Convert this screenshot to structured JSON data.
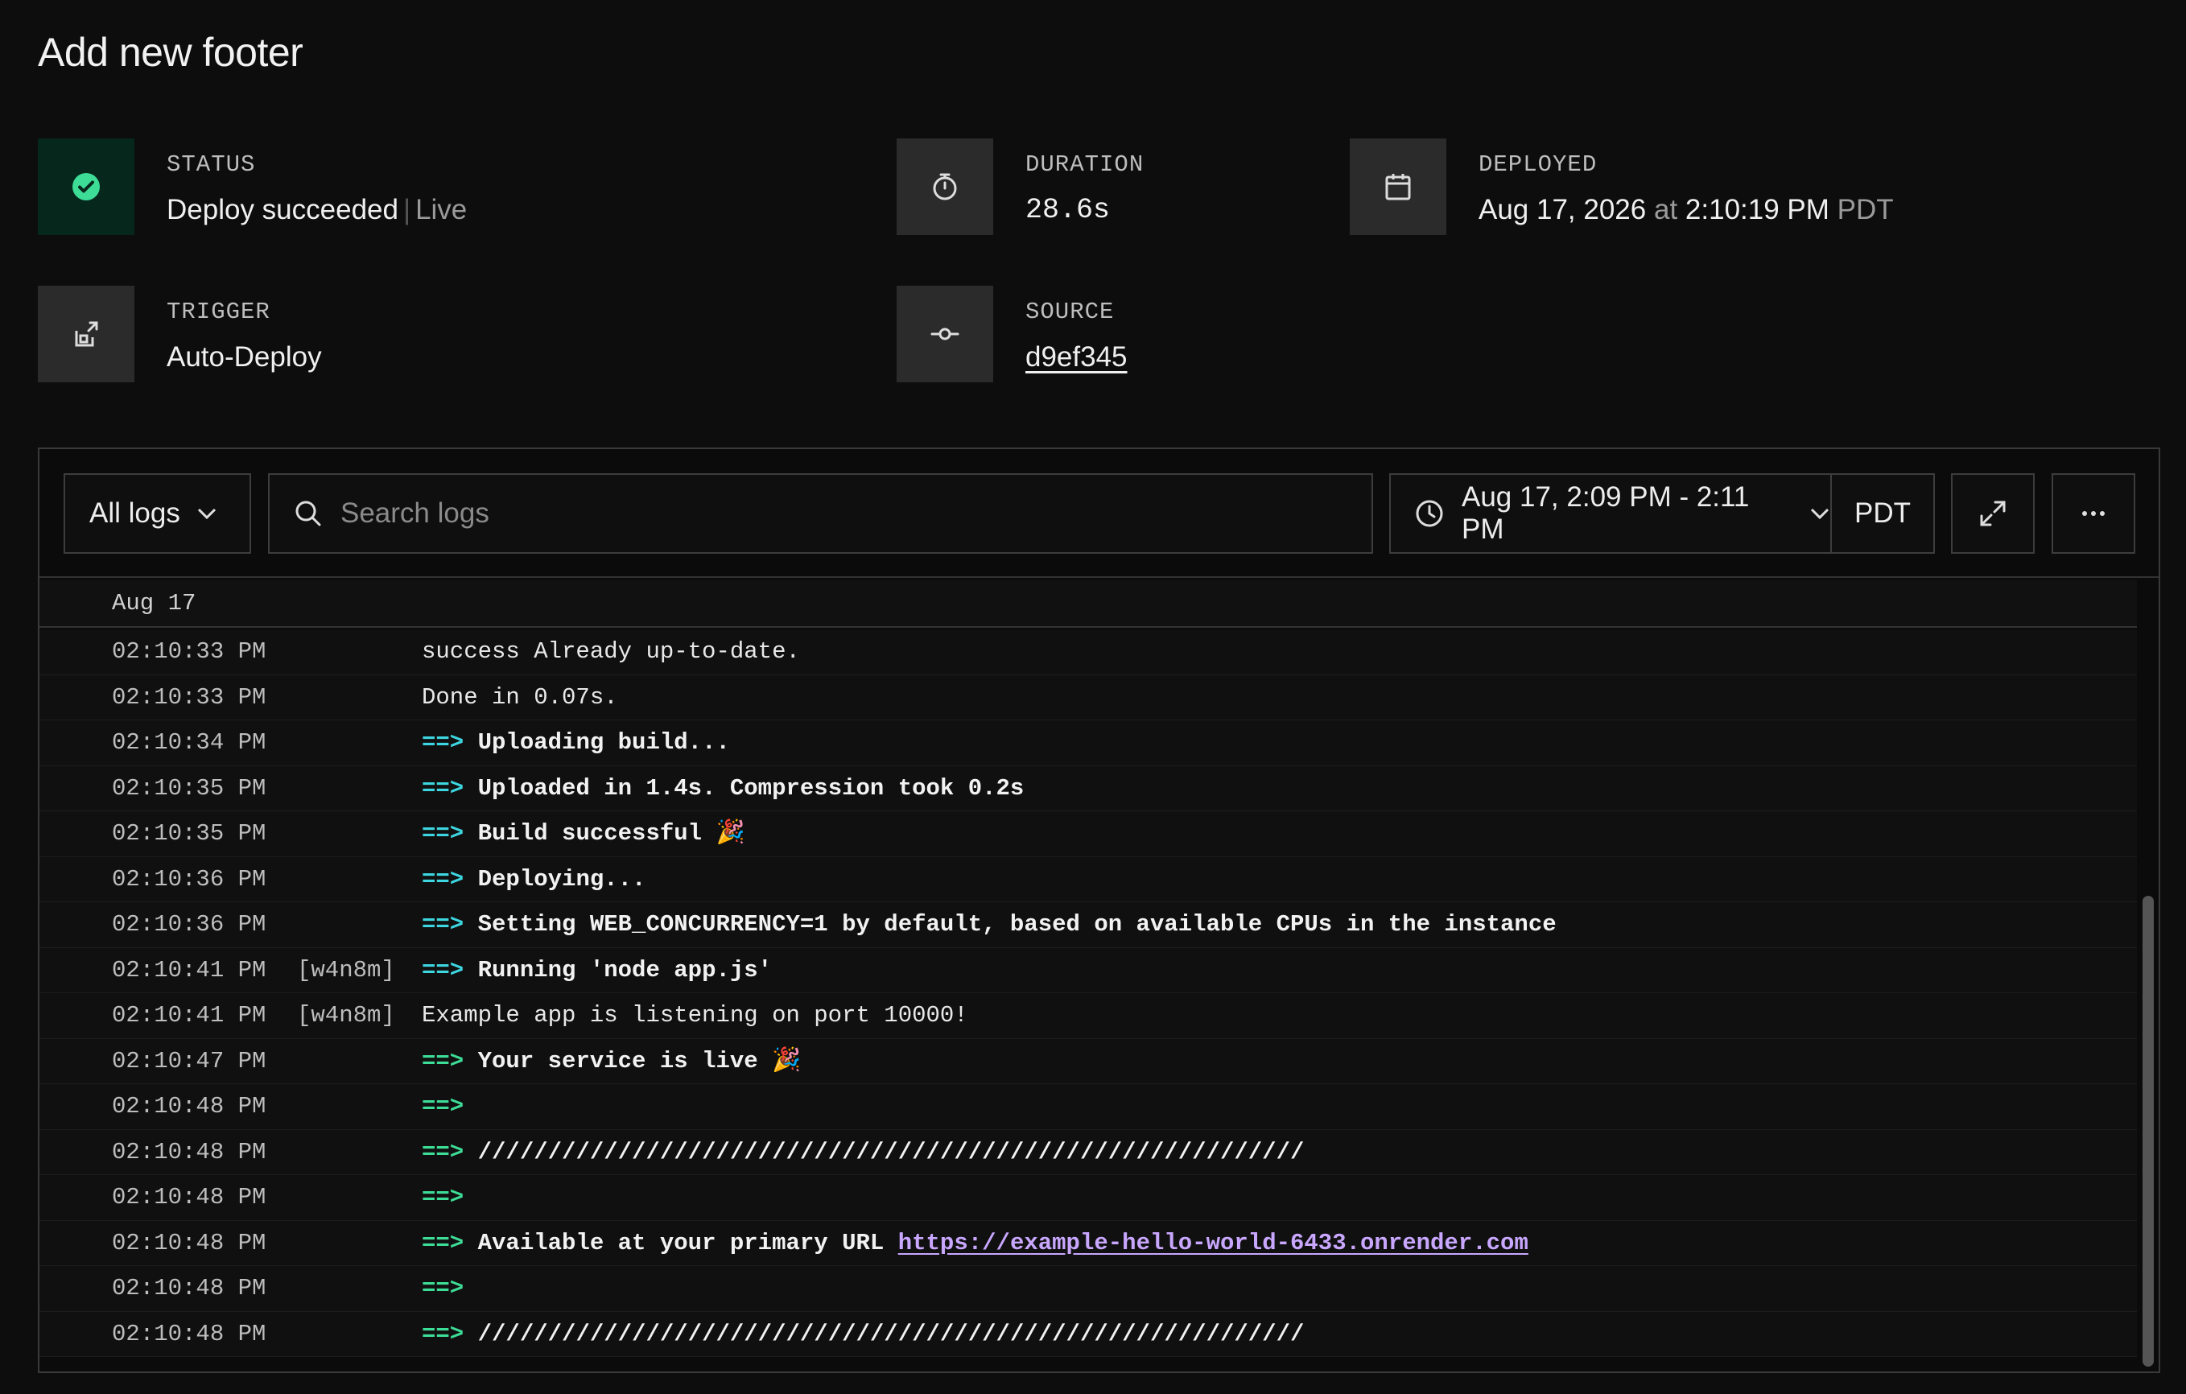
{
  "page": {
    "title": "Add new footer"
  },
  "meta": {
    "status": {
      "label": "STATUS",
      "value": "Deploy succeeded",
      "extra": "Live"
    },
    "duration": {
      "label": "DURATION",
      "value": "28.6s"
    },
    "deployed": {
      "label": "DEPLOYED",
      "date": "Aug 17, 2026",
      "at": "at",
      "time": "2:10:19 PM",
      "tz": "PDT"
    },
    "trigger": {
      "label": "TRIGGER",
      "value": "Auto-Deploy"
    },
    "source": {
      "label": "SOURCE",
      "value": "d9ef345"
    }
  },
  "toolbar": {
    "filter_label": "All logs",
    "search_placeholder": "Search logs",
    "range_label": "Aug 17, 2:09 PM - 2:11 PM",
    "tz_label": "PDT"
  },
  "logs": {
    "day": "Aug 17",
    "rows": [
      {
        "ts": "02:10:33 PM",
        "inst": "",
        "arrow": "",
        "msg": "success Already up-to-date.",
        "bold": false
      },
      {
        "ts": "02:10:33 PM",
        "inst": "",
        "arrow": "",
        "msg": "Done in 0.07s.",
        "bold": false
      },
      {
        "ts": "02:10:34 PM",
        "inst": "",
        "arrow": "==>",
        "msg": "Uploading build...",
        "bold": true
      },
      {
        "ts": "02:10:35 PM",
        "inst": "",
        "arrow": "==>",
        "msg": "Uploaded in 1.4s. Compression took 0.2s",
        "bold": true
      },
      {
        "ts": "02:10:35 PM",
        "inst": "",
        "arrow": "==>",
        "msg": "Build successful 🎉",
        "bold": true
      },
      {
        "ts": "02:10:36 PM",
        "inst": "",
        "arrow": "==>",
        "msg": "Deploying...",
        "bold": true
      },
      {
        "ts": "02:10:36 PM",
        "inst": "",
        "arrow": "==>",
        "msg": "Setting WEB_CONCURRENCY=1 by default, based on available CPUs in the instance",
        "bold": true
      },
      {
        "ts": "02:10:41 PM",
        "inst": "[w4n8m]",
        "arrow": "==>",
        "msg": "Running 'node app.js'",
        "bold": true
      },
      {
        "ts": "02:10:41 PM",
        "inst": "[w4n8m]",
        "arrow": "",
        "msg": "Example app is listening on port 10000!",
        "bold": false
      },
      {
        "ts": "02:10:47 PM",
        "inst": "",
        "arrow": "==>",
        "msg": "Your service is live 🎉",
        "bold": true
      },
      {
        "ts": "02:10:48 PM",
        "inst": "",
        "arrow": "==>",
        "msg": "",
        "bold": true
      },
      {
        "ts": "02:10:48 PM",
        "inst": "",
        "arrow": "==>",
        "msg": "///////////////////////////////////////////////////////////",
        "bold": true
      },
      {
        "ts": "02:10:48 PM",
        "inst": "",
        "arrow": "==>",
        "msg": "",
        "bold": true
      },
      {
        "ts": "02:10:48 PM",
        "inst": "",
        "arrow": "==>",
        "msg": "Available at your primary URL ",
        "bold": true,
        "url": "https://example-hello-world-6433.onrender.com"
      },
      {
        "ts": "02:10:48 PM",
        "inst": "",
        "arrow": "==>",
        "msg": "",
        "bold": true
      },
      {
        "ts": "02:10:48 PM",
        "inst": "",
        "arrow": "==>",
        "msg": "///////////////////////////////////////////////////////////",
        "bold": true
      }
    ]
  },
  "colors": {
    "accent_success": "#3ddc97",
    "arrow": "#3dd6e0",
    "link": "#c9a7ff"
  }
}
